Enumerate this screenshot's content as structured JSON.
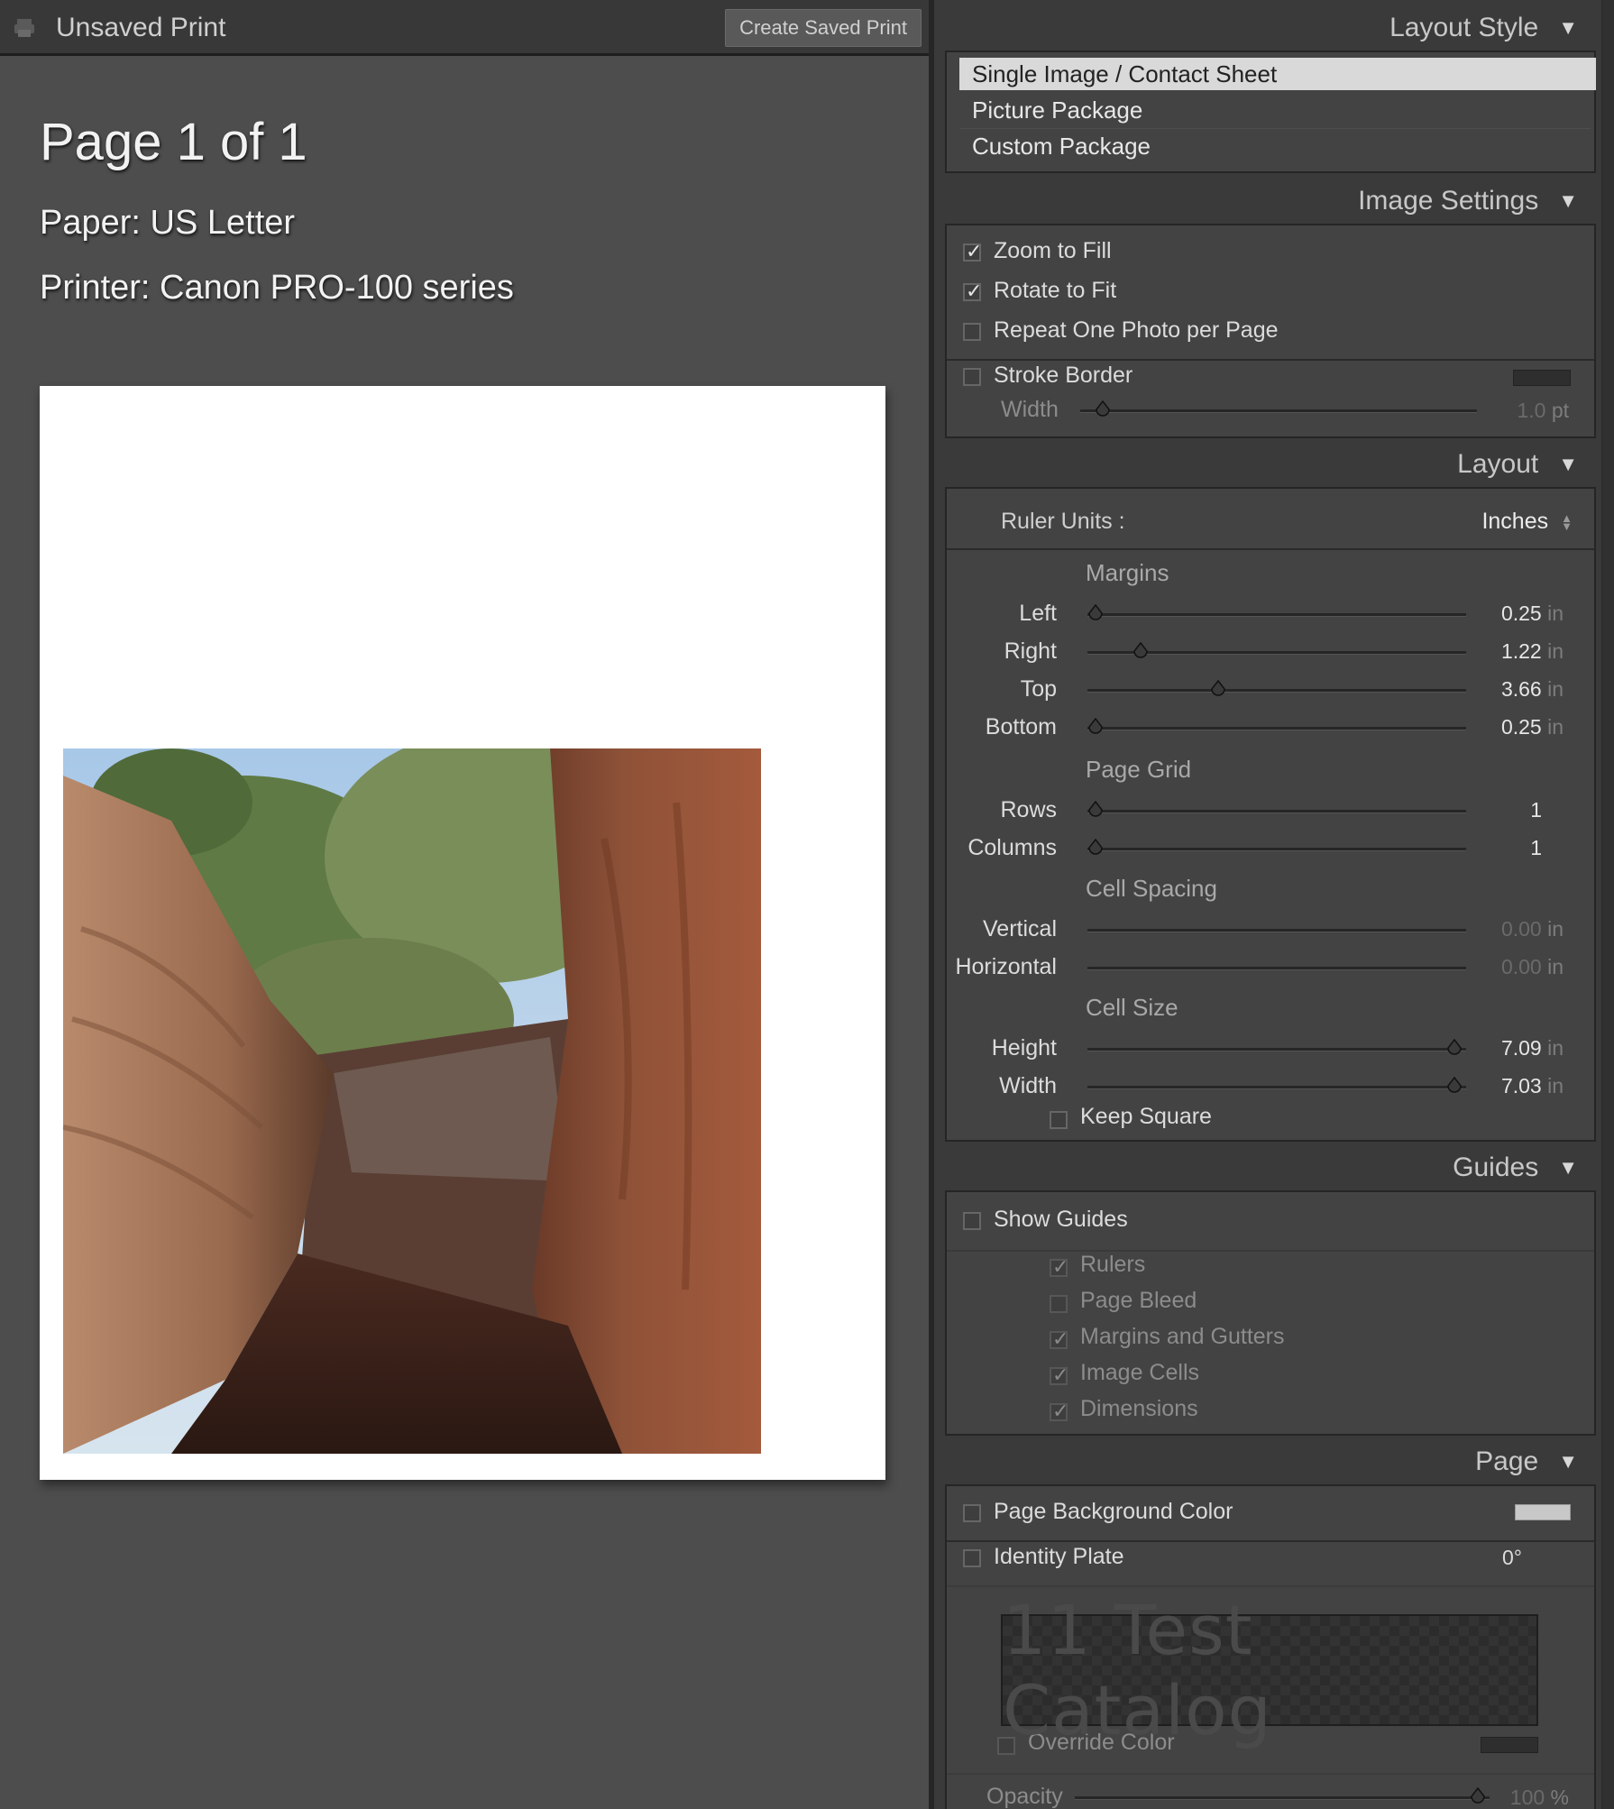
{
  "topbar": {
    "title": "Unsaved Print",
    "create_button": "Create Saved Print"
  },
  "preview": {
    "page_count": "Page 1 of 1",
    "paper": "Paper:  US Letter",
    "printer": "Printer:  Canon PRO-100 series"
  },
  "layout_style": {
    "header": "Layout Style",
    "items": [
      "Single Image / Contact Sheet",
      "Picture Package",
      "Custom Package"
    ],
    "selected": 0
  },
  "image_settings": {
    "header": "Image Settings",
    "zoom_to_fill": {
      "label": "Zoom to Fill",
      "checked": true
    },
    "rotate_to_fit": {
      "label": "Rotate to Fit",
      "checked": true
    },
    "repeat_one": {
      "label": "Repeat One Photo per Page",
      "checked": false
    },
    "stroke_border": {
      "label": "Stroke Border",
      "checked": false
    },
    "width": {
      "label": "Width",
      "value": "1.0",
      "unit": "pt"
    }
  },
  "layout": {
    "header": "Layout",
    "ruler_units_label": "Ruler Units :",
    "ruler_units_value": "Inches",
    "margins_title": "Margins",
    "left": {
      "label": "Left",
      "value": "0.25",
      "unit": "in"
    },
    "right": {
      "label": "Right",
      "value": "1.22",
      "unit": "in"
    },
    "top": {
      "label": "Top",
      "value": "3.66",
      "unit": "in"
    },
    "bottom": {
      "label": "Bottom",
      "value": "0.25",
      "unit": "in"
    },
    "page_grid_title": "Page Grid",
    "rows": {
      "label": "Rows",
      "value": "1"
    },
    "columns": {
      "label": "Columns",
      "value": "1"
    },
    "cell_spacing_title": "Cell Spacing",
    "vertical": {
      "label": "Vertical",
      "value": "0.00",
      "unit": "in"
    },
    "horizontal": {
      "label": "Horizontal",
      "value": "0.00",
      "unit": "in"
    },
    "cell_size_title": "Cell Size",
    "height": {
      "label": "Height",
      "value": "7.09",
      "unit": "in"
    },
    "width": {
      "label": "Width",
      "value": "7.03",
      "unit": "in"
    },
    "keep_square": {
      "label": "Keep Square",
      "checked": false
    }
  },
  "guides": {
    "header": "Guides",
    "show_guides": {
      "label": "Show Guides",
      "checked": false
    },
    "rulers": {
      "label": "Rulers",
      "checked": true
    },
    "page_bleed": {
      "label": "Page Bleed",
      "checked": false
    },
    "margins_gutters": {
      "label": "Margins and Gutters",
      "checked": true
    },
    "image_cells": {
      "label": "Image Cells",
      "checked": true
    },
    "dimensions": {
      "label": "Dimensions",
      "checked": true
    }
  },
  "page": {
    "header": "Page",
    "page_bg": {
      "label": "Page Background Color",
      "checked": false
    },
    "identity_plate": {
      "label": "Identity Plate",
      "checked": false,
      "angle": "0°"
    },
    "plate_text": "11 Test Catalog",
    "override_color": {
      "label": "Override Color",
      "checked": false
    },
    "opacity": {
      "label": "Opacity",
      "value": "100",
      "unit": "%"
    }
  },
  "colors": {
    "panel_bg": "#3a3a3a",
    "preview_bg": "#4d4d4d",
    "selected_item": "#d9d9d9",
    "page_bg_swatch": "#c8c8c8"
  }
}
